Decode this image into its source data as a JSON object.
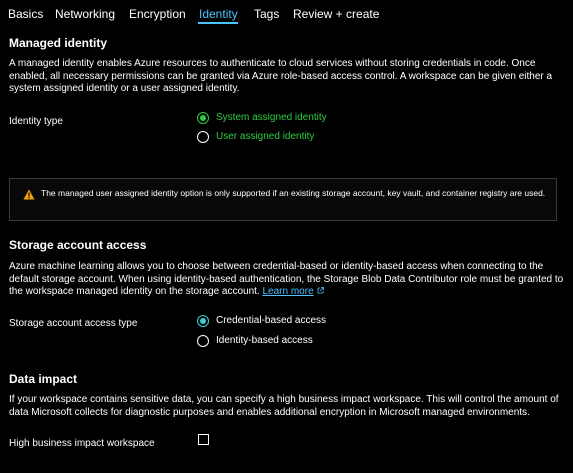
{
  "tabs": [
    "Basics",
    "Networking",
    "Encryption",
    "Identity",
    "Tags",
    "Review + create"
  ],
  "active_tab": "Identity",
  "colors": {
    "accent": "#4cc2ff",
    "green": "#2ecc40",
    "warning": "#f0a30a",
    "cyan": "#36d1d6"
  },
  "managed_identity": {
    "title": "Managed identity",
    "description": "A managed identity enables Azure resources to authenticate to cloud services without storing credentials in code. Once enabled, all necessary permissions can be granted via Azure role-based access control. A workspace can be given either a system assigned identity or a user assigned identity.",
    "identity_type_label": "Identity type",
    "options": [
      "System assigned identity",
      "User assigned identity"
    ],
    "selected": "System assigned identity"
  },
  "warning": {
    "icon": "warning-icon",
    "text": "The managed user assigned identity option is only supported if an existing storage account, key vault, and container registry are used."
  },
  "storage_access": {
    "title": "Storage account access",
    "description": "Azure machine learning allows you to choose between credential-based or identity-based access when connecting to the default storage account. When using identity-based authentication, the Storage Blob Data Contributor role must be granted to the workspace managed identity on the storage account.",
    "learn_more": "Learn more",
    "access_type_label": "Storage account access type",
    "options": [
      "Credential-based access",
      "Identity-based access"
    ],
    "selected": "Credential-based access"
  },
  "data_impact": {
    "title": "Data impact",
    "description": "If your workspace contains sensitive data, you can specify a high business impact workspace. This will control the amount of data Microsoft collects for diagnostic purposes and enables additional encryption in Microsoft managed environments.",
    "hbi_label": "High business impact workspace",
    "hbi_checked": false
  }
}
